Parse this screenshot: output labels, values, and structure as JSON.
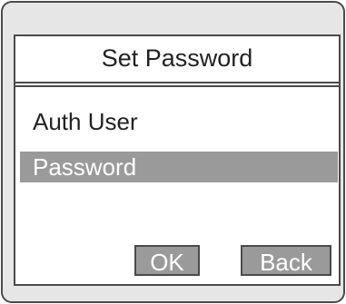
{
  "dialog": {
    "title": "Set Password"
  },
  "menu": {
    "items": [
      {
        "label": "Auth User",
        "selected": false
      },
      {
        "label": "Password",
        "selected": true
      }
    ]
  },
  "buttons": {
    "ok_label": "OK",
    "back_label": "Back"
  },
  "colors": {
    "highlight": "#9a9a9a",
    "frame": "#4a4a4a",
    "bezel": "#e6e6e6",
    "screen": "#ffffff"
  }
}
